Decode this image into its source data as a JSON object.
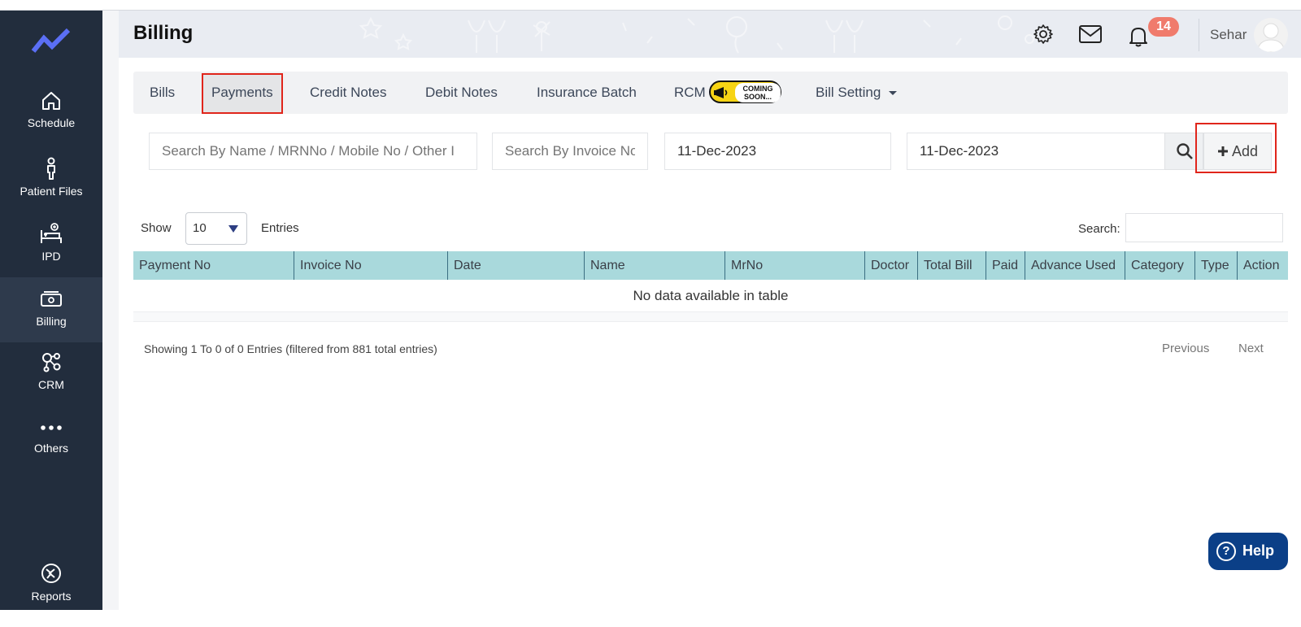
{
  "sidebar": {
    "items": [
      {
        "label": "Schedule",
        "icon": "home-icon"
      },
      {
        "label": "Patient Files",
        "icon": "person-icon"
      },
      {
        "label": "IPD",
        "icon": "bed-icon"
      },
      {
        "label": "Billing",
        "icon": "cash-icon",
        "active": true
      },
      {
        "label": "CRM",
        "icon": "network-icon"
      },
      {
        "label": "Others",
        "icon": "more-icon"
      },
      {
        "label": "Reports",
        "icon": "chart-pie-icon"
      }
    ]
  },
  "header": {
    "title": "Billing",
    "notification_count": "14",
    "user_name": "Sehar"
  },
  "tabs": {
    "bills": "Bills",
    "payments": "Payments",
    "credit_notes": "Credit Notes",
    "debit_notes": "Debit Notes",
    "insurance_batch": "Insurance Batch",
    "rcm": "RCM",
    "coming_soon": "COMING SOON...",
    "bill_setting": "Bill Setting"
  },
  "filters": {
    "name_placeholder": "Search By Name / MRNNo / Mobile No / Other I",
    "invoice_placeholder": "Search By Invoice No",
    "from_date": "11-Dec-2023",
    "to_date": "11-Dec-2023",
    "add_label": "Add"
  },
  "table_controls": {
    "show_label": "Show",
    "entries_value": "10",
    "entries_label": "Entries",
    "search_label": "Search:"
  },
  "table": {
    "columns": [
      "Payment No",
      "Invoice No",
      "Date",
      "Name",
      "MrNo",
      "Doctor",
      "Total Bill",
      "Paid",
      "Advance Used",
      "Category",
      "Type",
      "Action"
    ],
    "empty_message": "No data available in table"
  },
  "footer": {
    "info": "Showing 1 To 0 of 0 Entries (filtered from 881 total entries)",
    "previous": "Previous",
    "next": "Next"
  },
  "help": {
    "label": "Help"
  },
  "colors": {
    "sidebar_bg": "#222d3d",
    "table_header_bg": "#a9d9dc",
    "highlight_red": "#e0251b",
    "help_bg": "#0b3f87",
    "badge_bg": "#f07b6c"
  }
}
